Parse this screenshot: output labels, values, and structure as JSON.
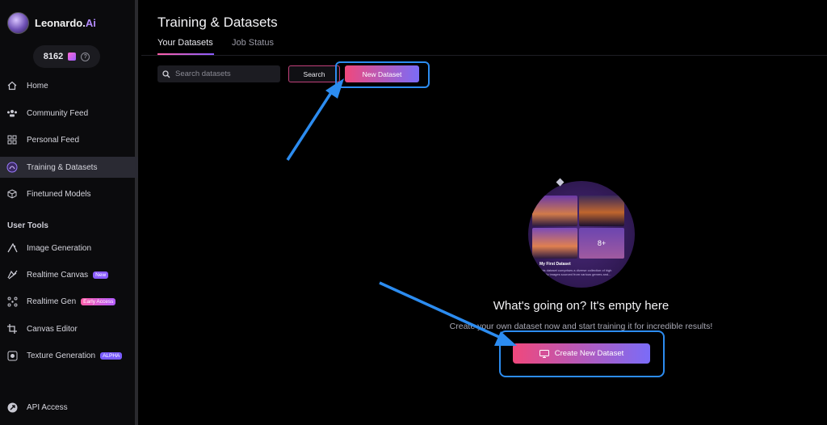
{
  "brand": {
    "name": "Leonardo.",
    "name_suffix": "Ai"
  },
  "credits": {
    "count": "8162",
    "info": "?"
  },
  "nav": [
    {
      "label": "Home",
      "icon": "home-icon"
    },
    {
      "label": "Community Feed",
      "icon": "community-icon"
    },
    {
      "label": "Personal Feed",
      "icon": "grid-icon"
    },
    {
      "label": "Training & Datasets",
      "icon": "training-icon",
      "active": true
    },
    {
      "label": "Finetuned Models",
      "icon": "cube-icon"
    }
  ],
  "user_tools": {
    "heading": "User Tools",
    "items": [
      {
        "label": "Image Generation",
        "icon": "image-gen-icon"
      },
      {
        "label": "Realtime Canvas",
        "icon": "canvas-icon",
        "badge": "New"
      },
      {
        "label": "Realtime Gen",
        "icon": "realtime-gen-icon",
        "badge": "Early Access"
      },
      {
        "label": "Canvas Editor",
        "icon": "crop-icon"
      },
      {
        "label": "Texture Generation",
        "icon": "texture-icon",
        "badge": "ALPHA"
      }
    ]
  },
  "api": {
    "label": "API Access",
    "icon": "api-icon"
  },
  "page": {
    "title": "Training & Datasets",
    "tabs": [
      "Your Datasets",
      "Job Status"
    ],
    "active_tab": "Your Datasets"
  },
  "toolbar": {
    "search_placeholder": "Search datasets",
    "search_label": "Search",
    "new_dataset_label": "New Dataset"
  },
  "empty_state": {
    "card_title": "My First Dataset",
    "card_text": "This dataset comprises a diverse collection of high quality images sourced from various genres and...",
    "thumb_count": "8+",
    "title": "What's going on? It's empty here",
    "subtitle": "Create your own dataset now and start training it for incredible results!",
    "create_label": "Create New Dataset"
  },
  "colors": {
    "accent_pink": "#f0487c",
    "accent_purple": "#7a6cf8",
    "highlight_blue": "#2c8cf0"
  }
}
